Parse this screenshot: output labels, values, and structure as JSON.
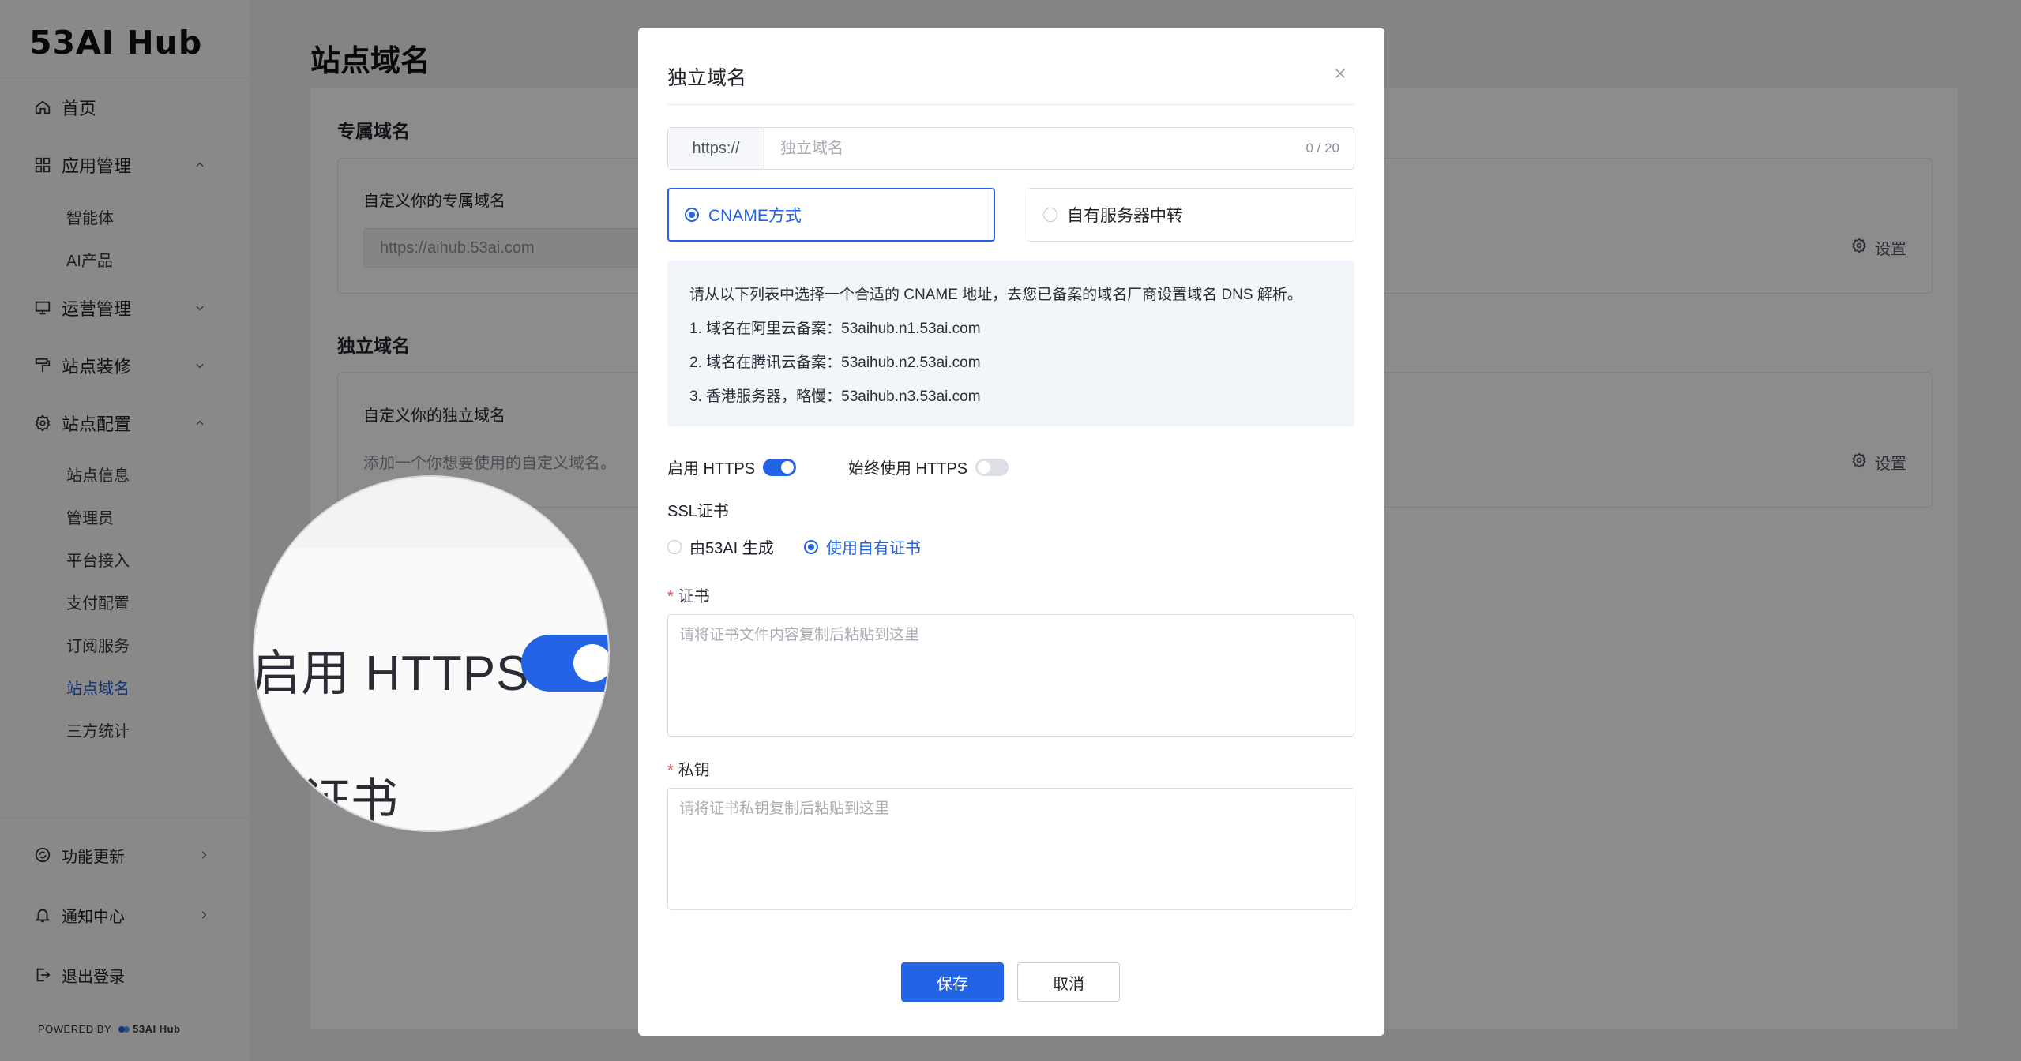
{
  "sidebar": {
    "brand": "53AI Hub",
    "items": [
      {
        "label": "首页"
      },
      {
        "label": "应用管理"
      },
      {
        "label": "运营管理"
      },
      {
        "label": "站点装修"
      },
      {
        "label": "站点配置"
      }
    ],
    "app_sub": [
      "智能体",
      "AI产品"
    ],
    "config_sub": [
      "站点信息",
      "管理员",
      "平台接入",
      "支付配置",
      "订阅服务",
      "站点域名",
      "三方统计"
    ],
    "bottom": [
      {
        "label": "功能更新"
      },
      {
        "label": "通知中心"
      },
      {
        "label": "退出登录"
      }
    ],
    "powered_by": "POWERED BY",
    "powered_logo": "53AI Hub"
  },
  "main": {
    "page_title": "站点域名",
    "exclusive": {
      "section_title": "专属域名",
      "label": "自定义你的专属域名",
      "value": "https://aihub.53ai.com",
      "settings": "设置"
    },
    "independent": {
      "section_title": "独立域名",
      "label": "自定义你的独立域名",
      "hint": "添加一个你想要使用的自定义域名。",
      "settings": "设置"
    }
  },
  "magnifier": {
    "label": "启用 HTTPS",
    "cert_text": "证书"
  },
  "modal": {
    "title": "独立域名",
    "url_prefix": "https://",
    "url_placeholder": "独立域名",
    "url_count": "0 / 20",
    "mode_cname": "CNAME方式",
    "mode_proxy": "自有服务器中转",
    "info": [
      "请从以下列表中选择一个合适的 CNAME 地址，去您已备案的域名厂商设置域名 DNS 解析。",
      "1. 域名在阿里云备案：53aihub.n1.53ai.com",
      "2. 域名在腾讯云备案：53aihub.n2.53ai.com",
      "3. 香港服务器，略慢：53aihub.n3.53ai.com"
    ],
    "enable_https": "启用 HTTPS",
    "enable_https_on": true,
    "always_https": "始终使用 HTTPS",
    "always_https_on": false,
    "ssl_label": "SSL证书",
    "ssl_option_generated": "由53AI 生成",
    "ssl_option_own": "使用自有证书",
    "cert_label": "证书",
    "cert_placeholder": "请将证书文件内容复制后粘贴到这里",
    "key_label": "私钥",
    "key_placeholder": "请将证书私钥复制后粘贴到这里",
    "save": "保存",
    "cancel": "取消"
  }
}
